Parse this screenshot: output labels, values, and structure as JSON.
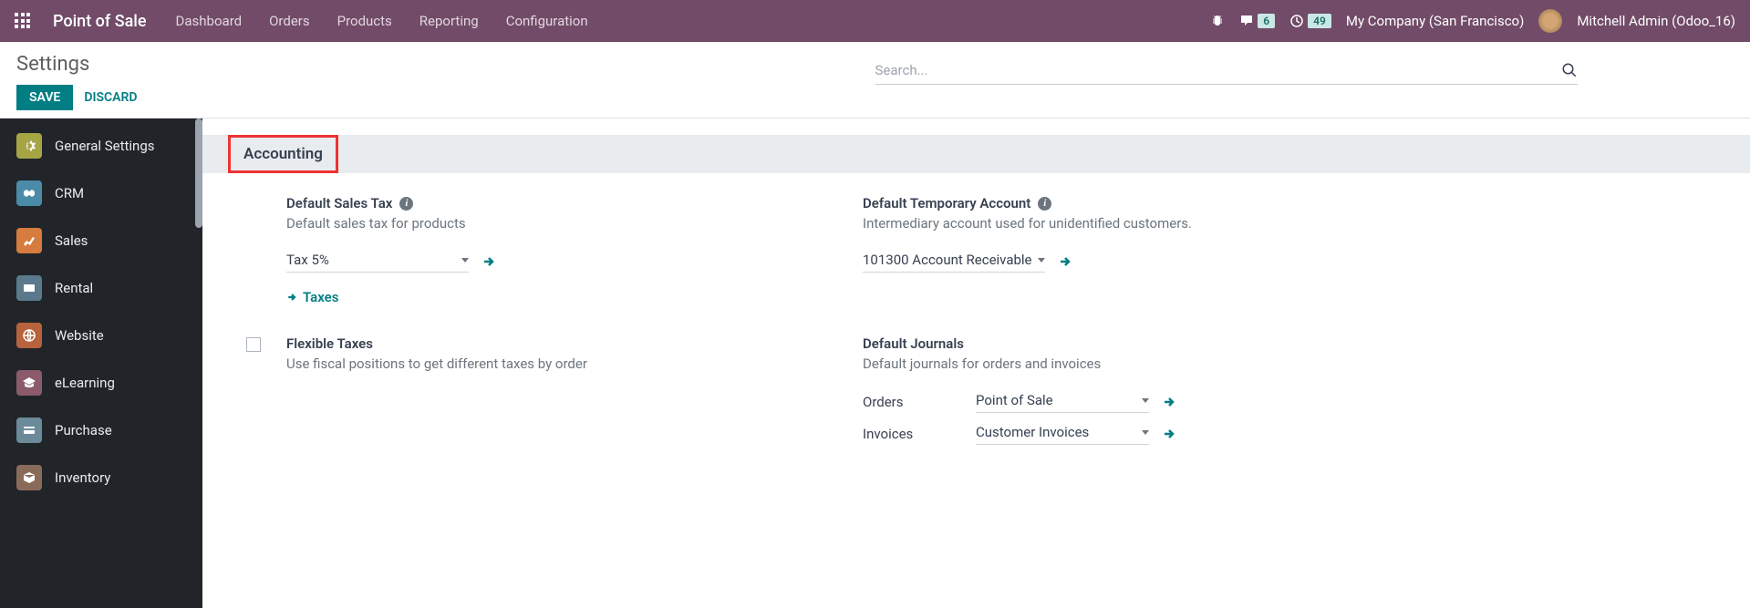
{
  "navbar": {
    "brand": "Point of Sale",
    "links": [
      "Dashboard",
      "Orders",
      "Products",
      "Reporting",
      "Configuration"
    ],
    "messages_badge": "6",
    "activities_badge": "49",
    "company": "My Company (San Francisco)",
    "user": "Mitchell Admin (Odoo_16)"
  },
  "control_panel": {
    "title": "Settings",
    "save": "SAVE",
    "discard": "DISCARD",
    "search_placeholder": "Search..."
  },
  "sidebar": {
    "items": [
      {
        "label": "General Settings"
      },
      {
        "label": "CRM"
      },
      {
        "label": "Sales"
      },
      {
        "label": "Rental"
      },
      {
        "label": "Website"
      },
      {
        "label": "eLearning"
      },
      {
        "label": "Purchase"
      },
      {
        "label": "Inventory"
      }
    ]
  },
  "section": {
    "title": "Accounting"
  },
  "settings": {
    "default_sales_tax": {
      "title": "Default Sales Tax",
      "desc": "Default sales tax for products",
      "value": "Tax 5%",
      "link": "Taxes"
    },
    "default_temp_account": {
      "title": "Default Temporary Account",
      "desc": "Intermediary account used for unidentified customers.",
      "value": "101300 Account Receivable"
    },
    "flexible_taxes": {
      "title": "Flexible Taxes",
      "desc": "Use fiscal positions to get different taxes by order"
    },
    "default_journals": {
      "title": "Default Journals",
      "desc": "Default journals for orders and invoices",
      "orders_label": "Orders",
      "orders_value": "Point of Sale",
      "invoices_label": "Invoices",
      "invoices_value": "Customer Invoices"
    }
  }
}
